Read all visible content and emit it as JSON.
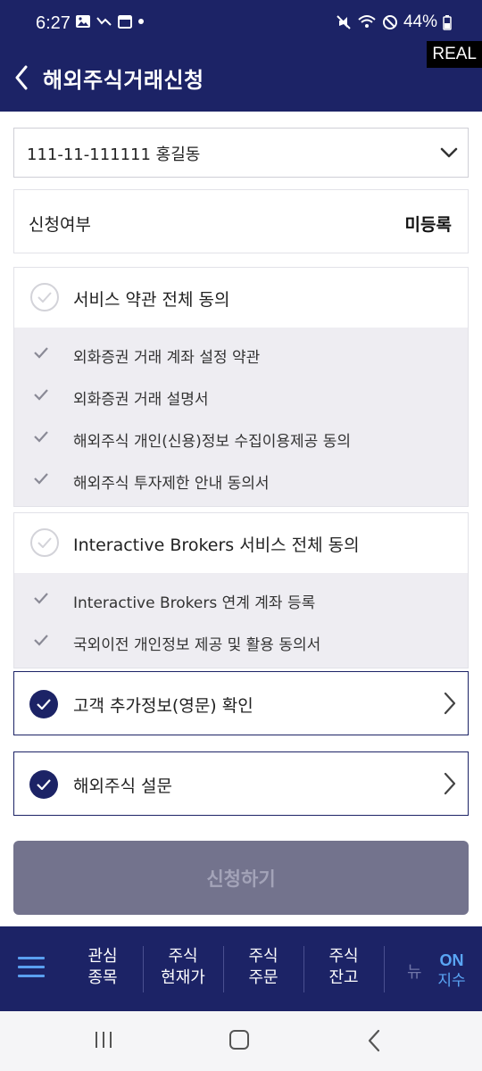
{
  "status_bar": {
    "time": "6:27",
    "battery": "44%"
  },
  "badge": "REAL",
  "header": {
    "title": "해외주식거래신청"
  },
  "account": {
    "value": "111-11-111111 홍길동"
  },
  "registration": {
    "label": "신청여부",
    "value": "미등록"
  },
  "group1": {
    "title": "서비스 약관 전체 동의",
    "items": [
      {
        "label": "외화증권 거래 계좌 설정 약관"
      },
      {
        "label": "외화증권 거래 설명서"
      },
      {
        "label": "해외주식 개인(신용)정보 수집이용제공 동의"
      },
      {
        "label": "해외주식 투자제한 안내 동의서"
      }
    ]
  },
  "group2": {
    "title": "Interactive Brokers 서비스 전체 동의",
    "items": [
      {
        "label": "Interactive Brokers 연계 계좌 등록"
      },
      {
        "label": "국외이전 개인정보 제공 및 활용 동의서"
      }
    ]
  },
  "links": [
    {
      "label": "고객 추가정보(영문) 확인"
    },
    {
      "label": "해외주식 설문"
    }
  ],
  "submit": {
    "label": "신청하기"
  },
  "bottom_nav": {
    "items": [
      {
        "line1": "관심",
        "line2": "종목"
      },
      {
        "line1": "주식",
        "line2": "현재가"
      },
      {
        "line1": "주식",
        "line2": "주문"
      },
      {
        "line1": "주식",
        "line2": "잔고"
      }
    ],
    "faded": "뉴",
    "on_label": "ON",
    "on_sub": "지수"
  },
  "colors": {
    "primary": "#1c2366",
    "check_grey": "#8a8a96",
    "submit_disabled": "#73738d",
    "accent_blue": "#5aa6f5"
  }
}
